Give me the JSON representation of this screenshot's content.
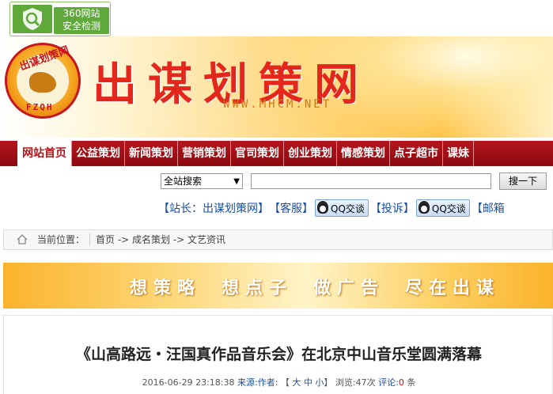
{
  "badge": {
    "line1": "360网站",
    "line2": "安全检测",
    "icon": "shield-magnifier-icon"
  },
  "header": {
    "logo_top": "出谋划策网",
    "logo_abbr": "FZQH",
    "site_title": "出谋划策网",
    "site_url": "WWW.MHCM.NET"
  },
  "nav": {
    "items": [
      "网站首页",
      "公益策划",
      "新闻策划",
      "营销策划",
      "官司策划",
      "创业策划",
      "情感策划",
      "点子超市",
      "课妹"
    ],
    "active_index": 0
  },
  "search": {
    "scope_selected": "全站搜索",
    "input_value": "",
    "button_label": "搜一下"
  },
  "contact": {
    "station_master": "【站长：出谋划策网】",
    "service": "【客服】",
    "qq_label_1": "QQ交谈",
    "complaint": "【投诉】",
    "qq_label_2": "QQ交谈",
    "mailbox": "【邮箱"
  },
  "breadcrumb": {
    "label": "当前位置：",
    "path": "首页 -> 成名策划 -> 文艺资讯"
  },
  "slogan": {
    "phrases": [
      "想策略",
      "想点子",
      "做广告",
      "尽在出谋"
    ]
  },
  "article": {
    "title": "《山高路远・汪国真作品音乐会》在北京中山音乐堂圆满落幕",
    "date": "2016-06-29 23:18:38",
    "source_label": "来源:",
    "author_label": "作者:",
    "font_size_prefix": "【",
    "size_large": "大",
    "size_medium": "中",
    "size_small": "小",
    "font_size_suffix": "】",
    "views_text": "浏览:47次",
    "comments_label": "评论:",
    "comments_count": "0",
    "comments_unit": "条"
  }
}
